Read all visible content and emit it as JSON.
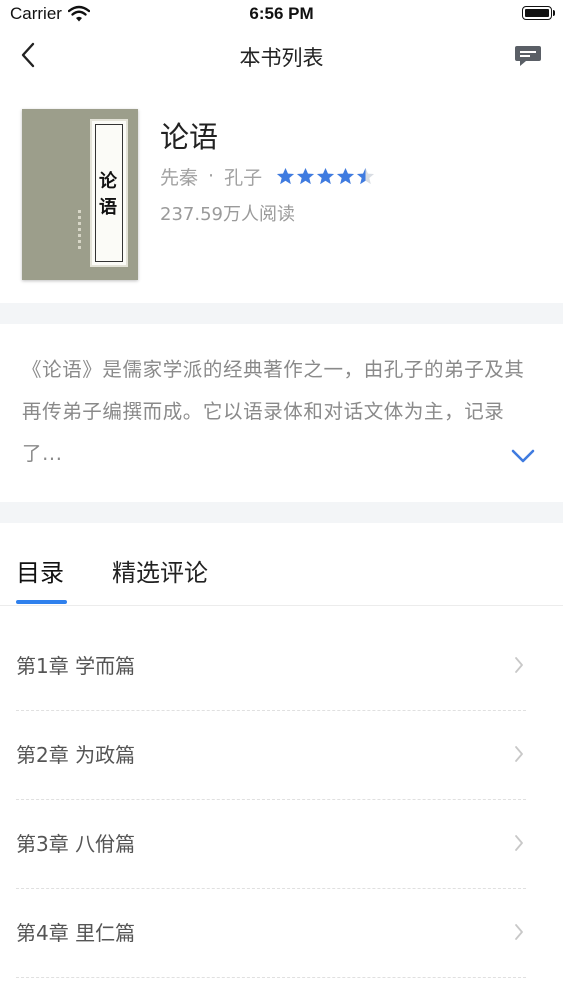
{
  "status_bar": {
    "carrier": "Carrier",
    "time": "6:56 PM"
  },
  "nav": {
    "title": "本书列表",
    "back_icon": "chevron-left-icon",
    "right_icon": "chat-bubble-icon"
  },
  "book": {
    "cover_title": "论语",
    "title": "论语",
    "era": "先秦",
    "separator": "·",
    "author": "孔子",
    "rating": 4.5,
    "rating_max": 5,
    "reads": "237.59万人阅读",
    "accent": "#3f7be0"
  },
  "intro": {
    "text": "《论语》是儒家学派的经典著作之一，由孔子的弟子及其再传弟子编撰而成。它以语录体和对话文体为主，记录了...",
    "expand_icon": "chevron-down-icon"
  },
  "tabs": [
    {
      "label": "目录",
      "active": true
    },
    {
      "label": "精选评论",
      "active": false
    }
  ],
  "chapters": [
    {
      "label": "第1章  学而篇"
    },
    {
      "label": "第2章  为政篇"
    },
    {
      "label": "第3章  八佾篇"
    },
    {
      "label": "第4章  里仁篇"
    }
  ],
  "colors": {
    "tab_indicator": "#2f80ed",
    "band": "#f3f5f7"
  }
}
